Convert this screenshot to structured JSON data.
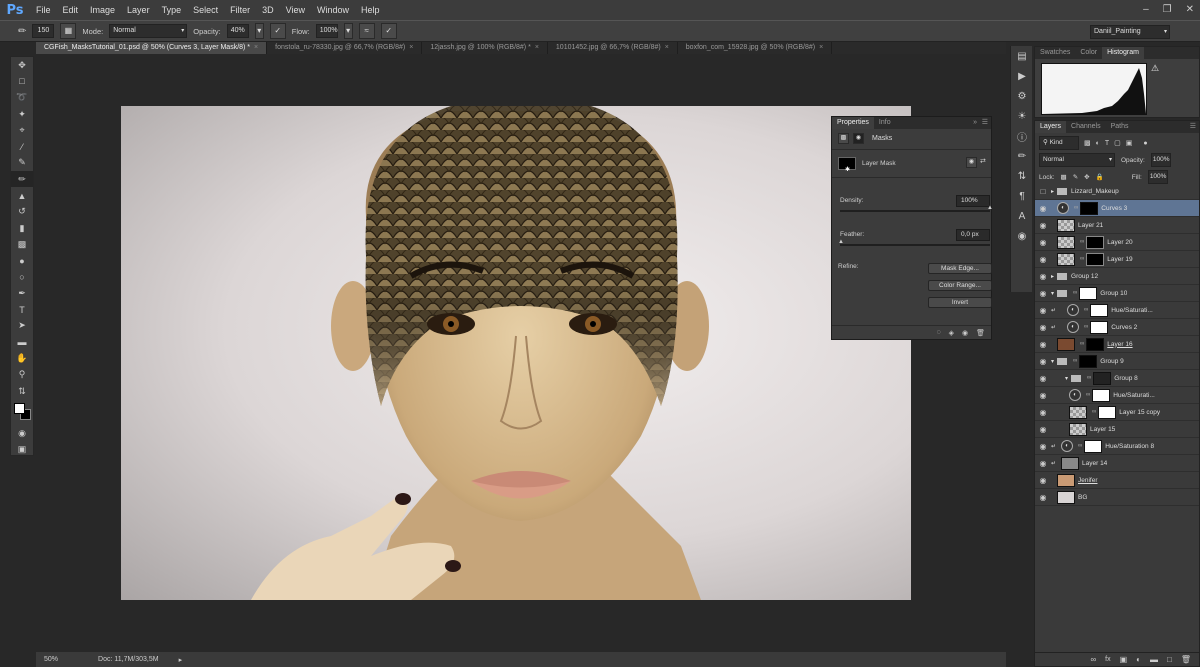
{
  "app": {
    "logo": "Ps"
  },
  "menu": [
    "File",
    "Edit",
    "Image",
    "Layer",
    "Type",
    "Select",
    "Filter",
    "3D",
    "View",
    "Window",
    "Help"
  ],
  "options": {
    "brush_size": "150",
    "mode_label": "Mode:",
    "mode_value": "Normal",
    "opacity_label": "Opacity:",
    "opacity_value": "40%",
    "flow_label": "Flow:",
    "flow_value": "100%",
    "workspace": "Daniil_Painting"
  },
  "tabs": [
    {
      "label": "CGFish_MasksTutorial_01.psd @ 50% (Curves 3, Layer Mask/8) *"
    },
    {
      "label": "fonstola_ru-78330.jpg @ 66,7% (RGB/8#)"
    },
    {
      "label": "12jassh.jpg @ 100% (RGB/8#) *"
    },
    {
      "label": "10101452.jpg @ 66,7% (RGB/8#)"
    },
    {
      "label": "boxfon_com_15928.jpg @ 50% (RGB/8#)"
    }
  ],
  "status": {
    "zoom": "50%",
    "doc": "Doc: 11,7M/303,5M"
  },
  "histogram_tabs": [
    "Swatches",
    "Color",
    "Histogram"
  ],
  "properties": {
    "tabs": [
      "Properties",
      "Info"
    ],
    "header": "Masks",
    "mask_name": "Layer Mask",
    "density_label": "Density:",
    "density_value": "100%",
    "feather_label": "Feather:",
    "feather_value": "0,0 px",
    "refine_label": "Refine:",
    "btn_mask_edge": "Mask Edge...",
    "btn_color_range": "Color Range...",
    "btn_invert": "Invert"
  },
  "layers_panel": {
    "tabs": [
      "Layers",
      "Channels",
      "Paths"
    ],
    "filter": "Kind",
    "blend": "Normal",
    "opacity_label": "Opacity:",
    "opacity_value": "100%",
    "lock_label": "Lock:",
    "fill_label": "Fill:",
    "fill_value": "100%",
    "layers": [
      {
        "name": "Lizzard_Makeup",
        "type": "group"
      },
      {
        "name": "Curves 3",
        "type": "adjustment",
        "selected": true
      },
      {
        "name": "Layer 21",
        "type": "pixel"
      },
      {
        "name": "Layer 20",
        "type": "pixel"
      },
      {
        "name": "Layer 19",
        "type": "pixel"
      },
      {
        "name": "Group 12",
        "type": "group"
      },
      {
        "name": "Group 10",
        "type": "group"
      },
      {
        "name": "Hue/Saturati...",
        "type": "adjustment"
      },
      {
        "name": "Curves 2",
        "type": "adjustment"
      },
      {
        "name": "Layer 16",
        "type": "pixel"
      },
      {
        "name": "Group 9",
        "type": "group"
      },
      {
        "name": "Group 8",
        "type": "group"
      },
      {
        "name": "Hue/Saturati...",
        "type": "adjustment"
      },
      {
        "name": "Layer 15 copy",
        "type": "pixel"
      },
      {
        "name": "Layer 15",
        "type": "pixel"
      },
      {
        "name": "Hue/Saturation 8",
        "type": "adjustment"
      },
      {
        "name": "Layer 14",
        "type": "pixel"
      },
      {
        "name": "Jenifer",
        "type": "pixel"
      },
      {
        "name": "BG",
        "type": "pixel"
      }
    ]
  }
}
